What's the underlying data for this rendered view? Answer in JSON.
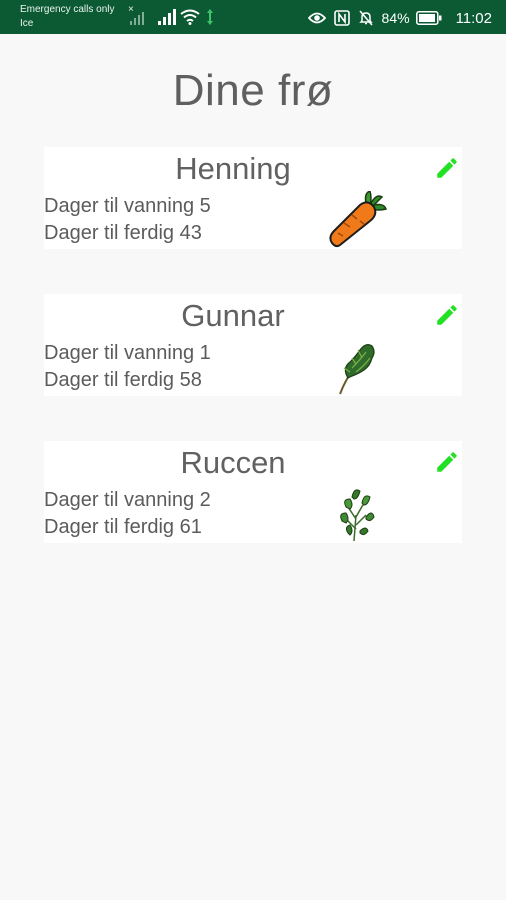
{
  "status_bar": {
    "carrier_line1": "Emergency calls only",
    "carrier_line2": "Ice",
    "battery_text": "84%",
    "time": "11:02"
  },
  "title": "Dine frø",
  "seeds": [
    {
      "name": "Henning",
      "water_text": "Dager til vanning 5",
      "done_text": "Dager til ferdig 43",
      "plant_icon": "carrot-icon"
    },
    {
      "name": "Gunnar",
      "water_text": "Dager til vanning 1",
      "done_text": "Dager til ferdig 58",
      "plant_icon": "herb-sprig-icon"
    },
    {
      "name": "Ruccen",
      "water_text": "Dager til vanning 2",
      "done_text": "Dager til ferdig 61",
      "plant_icon": "arugula-icon"
    }
  ],
  "colors": {
    "status_bar": "#0b5a34",
    "edit_icon": "#22e022",
    "background": "#f8f8f8"
  }
}
